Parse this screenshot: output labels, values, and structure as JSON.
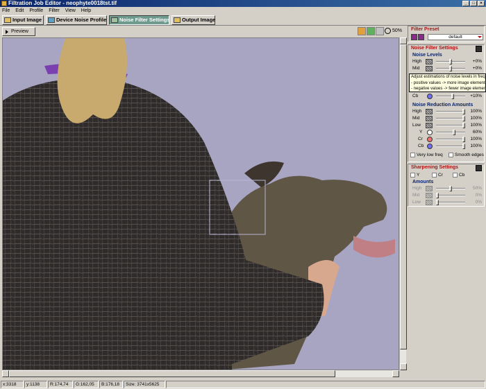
{
  "window": {
    "title": "Filtration Job Editor - neophyte0018tst.tif"
  },
  "menu": [
    "File",
    "Edit",
    "Profile",
    "Filter",
    "View",
    "Help"
  ],
  "tabs": [
    {
      "label": "Input Image",
      "icon": "input-image-icon"
    },
    {
      "label": "Device Noise Profile",
      "icon": "device-profile-icon"
    },
    {
      "label": "Noise Filter Settings",
      "icon": "filter-settings-icon",
      "active": true
    },
    {
      "label": "Output Image",
      "icon": "output-image-icon"
    }
  ],
  "viewer": {
    "preview_label": "Preview",
    "zoom": "50%",
    "tool_icons": [
      "palette-icon",
      "color-picker-icon",
      "hand-icon"
    ]
  },
  "filter_preset": {
    "title": "Filter Preset",
    "selected": "default"
  },
  "noise_filter_settings": {
    "title": "Noise Filter Settings",
    "noise_levels": {
      "title": "Noise Levels",
      "rows": [
        {
          "label": "High",
          "value": "+0%",
          "level": 0.5
        },
        {
          "label": "Mid",
          "value": "+0%",
          "level": 0.5
        }
      ],
      "cb_row": {
        "label": "Cb",
        "value": "+10%",
        "level": 0.55
      }
    },
    "tooltip": {
      "line1": "Adjust estimations of noise levels in frequ",
      "line2": "- positive values -> more image elements",
      "line3": "- negative values -> fewer image elemen"
    },
    "noise_reduction": {
      "title": "Noise Reduction Amounts",
      "rows": [
        {
          "label": "High",
          "value": "100%",
          "level": 1.0,
          "kind": "pattern"
        },
        {
          "label": "Mid",
          "value": "100%",
          "level": 1.0,
          "kind": "pattern"
        },
        {
          "label": "Low",
          "value": "100%",
          "level": 1.0,
          "kind": "pattern"
        },
        {
          "label": "Y",
          "value": "60%",
          "level": 0.6,
          "kind": "dot",
          "color": "#ffffff"
        },
        {
          "label": "Cr",
          "value": "100%",
          "level": 1.0,
          "kind": "dot",
          "color": "#f07070"
        },
        {
          "label": "Cb",
          "value": "100%",
          "level": 1.0,
          "kind": "dot",
          "color": "#7070f0"
        }
      ]
    },
    "options": {
      "very_low_freq": "Very low freq",
      "smooth_edges": "Smooth edges"
    }
  },
  "sharpening": {
    "title": "Sharpening Settings",
    "channels": {
      "y": "Y",
      "cr": "Cr",
      "cb": "Cb"
    },
    "amounts_title": "Amounts",
    "rows": [
      {
        "label": "High",
        "value": "50%",
        "level": 0.5
      },
      {
        "label": "Mid",
        "value": "0%",
        "level": 0.0
      },
      {
        "label": "Low",
        "value": "0%",
        "level": 0.0
      }
    ]
  },
  "status": {
    "x": "x:3318",
    "y": "y:1138",
    "r": "R:174,74",
    "g": "G:162,05",
    "b": "B:176,18",
    "size": "Size: 3741x5625"
  }
}
